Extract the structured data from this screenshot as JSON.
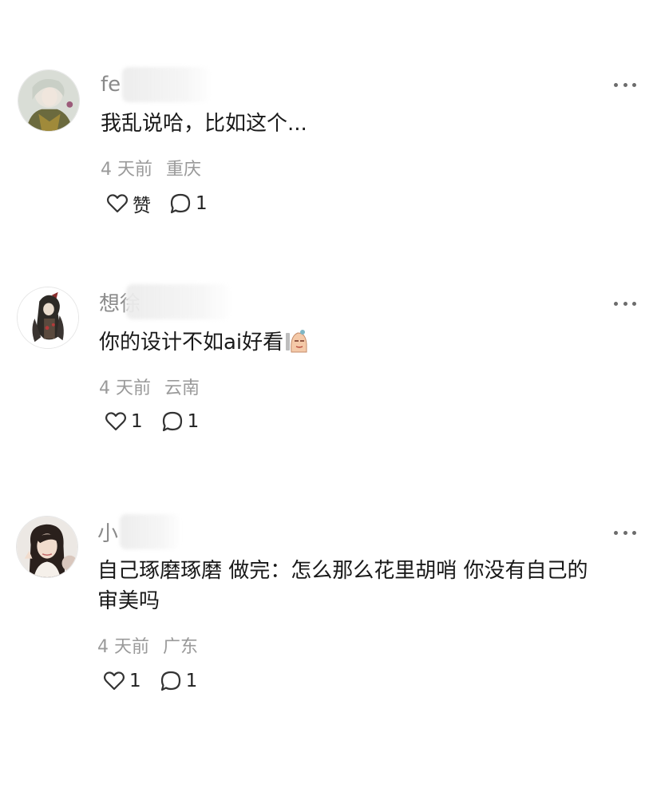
{
  "comments": [
    {
      "username": "fe",
      "text": "我乱说哈，比如这个...",
      "time": "4 天前",
      "location": "重庆",
      "like_label": "赞",
      "reply_count": "1"
    },
    {
      "username": "想徐",
      "text": "你的设计不如ai好看",
      "time": "4 天前",
      "location": "云南",
      "like_label": "1",
      "reply_count": "1"
    },
    {
      "username": "小",
      "text_line1": "自己琢磨琢磨 做完：怎么那么花里胡哨 你没有自己的",
      "text_line2": "审美吗",
      "time": "4 天前",
      "location": "广东",
      "like_label": "1",
      "reply_count": "1"
    }
  ],
  "icons": {
    "like": "heart-outline-icon",
    "reply": "speech-bubble-icon",
    "more": "ellipsis-icon"
  },
  "colors": {
    "text_primary": "#191919",
    "text_secondary": "#8a8a8a",
    "icon": "#333333"
  }
}
